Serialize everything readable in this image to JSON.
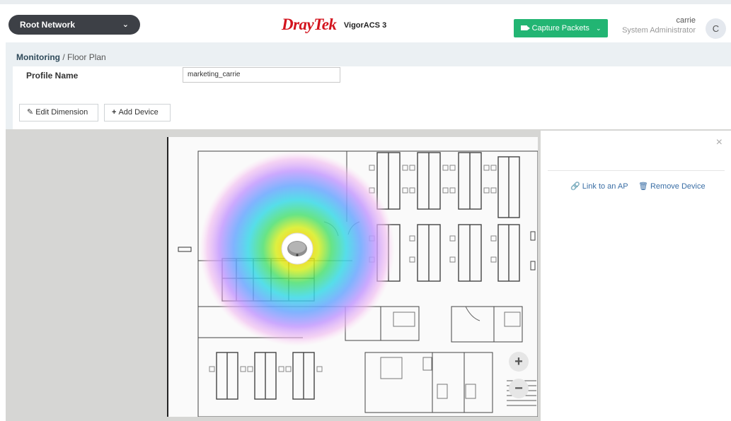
{
  "header": {
    "network_selector": "Root Network",
    "logo": "DrayTek",
    "product": "VigorACS 3",
    "capture_button": "Capture Packets",
    "user_name": "carrie",
    "user_role": "System Administrator",
    "avatar_initial": "C"
  },
  "breadcrumb": {
    "section": "Monitoring",
    "separator": "/",
    "page": "Floor Plan"
  },
  "profile": {
    "label": "Profile Name",
    "value": "marketing_carrie"
  },
  "toolbar": {
    "edit_dimension": "Edit Dimension",
    "add_device": "Add Device"
  },
  "zoom": {
    "in": "+",
    "out": "−"
  },
  "side_panel": {
    "close": "×",
    "link_ap": "Link to an AP",
    "remove_device": "Remove Device"
  },
  "icons": {
    "network_chevron": "chevron-down-icon",
    "capture_chevron": "chevron-down-icon",
    "camera": "video-camera-icon",
    "pencil": "pencil-icon",
    "plus": "plus-icon",
    "link": "link-icon",
    "trash": "trash-icon",
    "close": "close-icon"
  },
  "colors": {
    "brand_red": "#d3141e",
    "capture_green": "#22b573",
    "network_dark": "#3d4046",
    "page_bg": "#ebf0f3",
    "link_blue": "#3a6ea5"
  }
}
